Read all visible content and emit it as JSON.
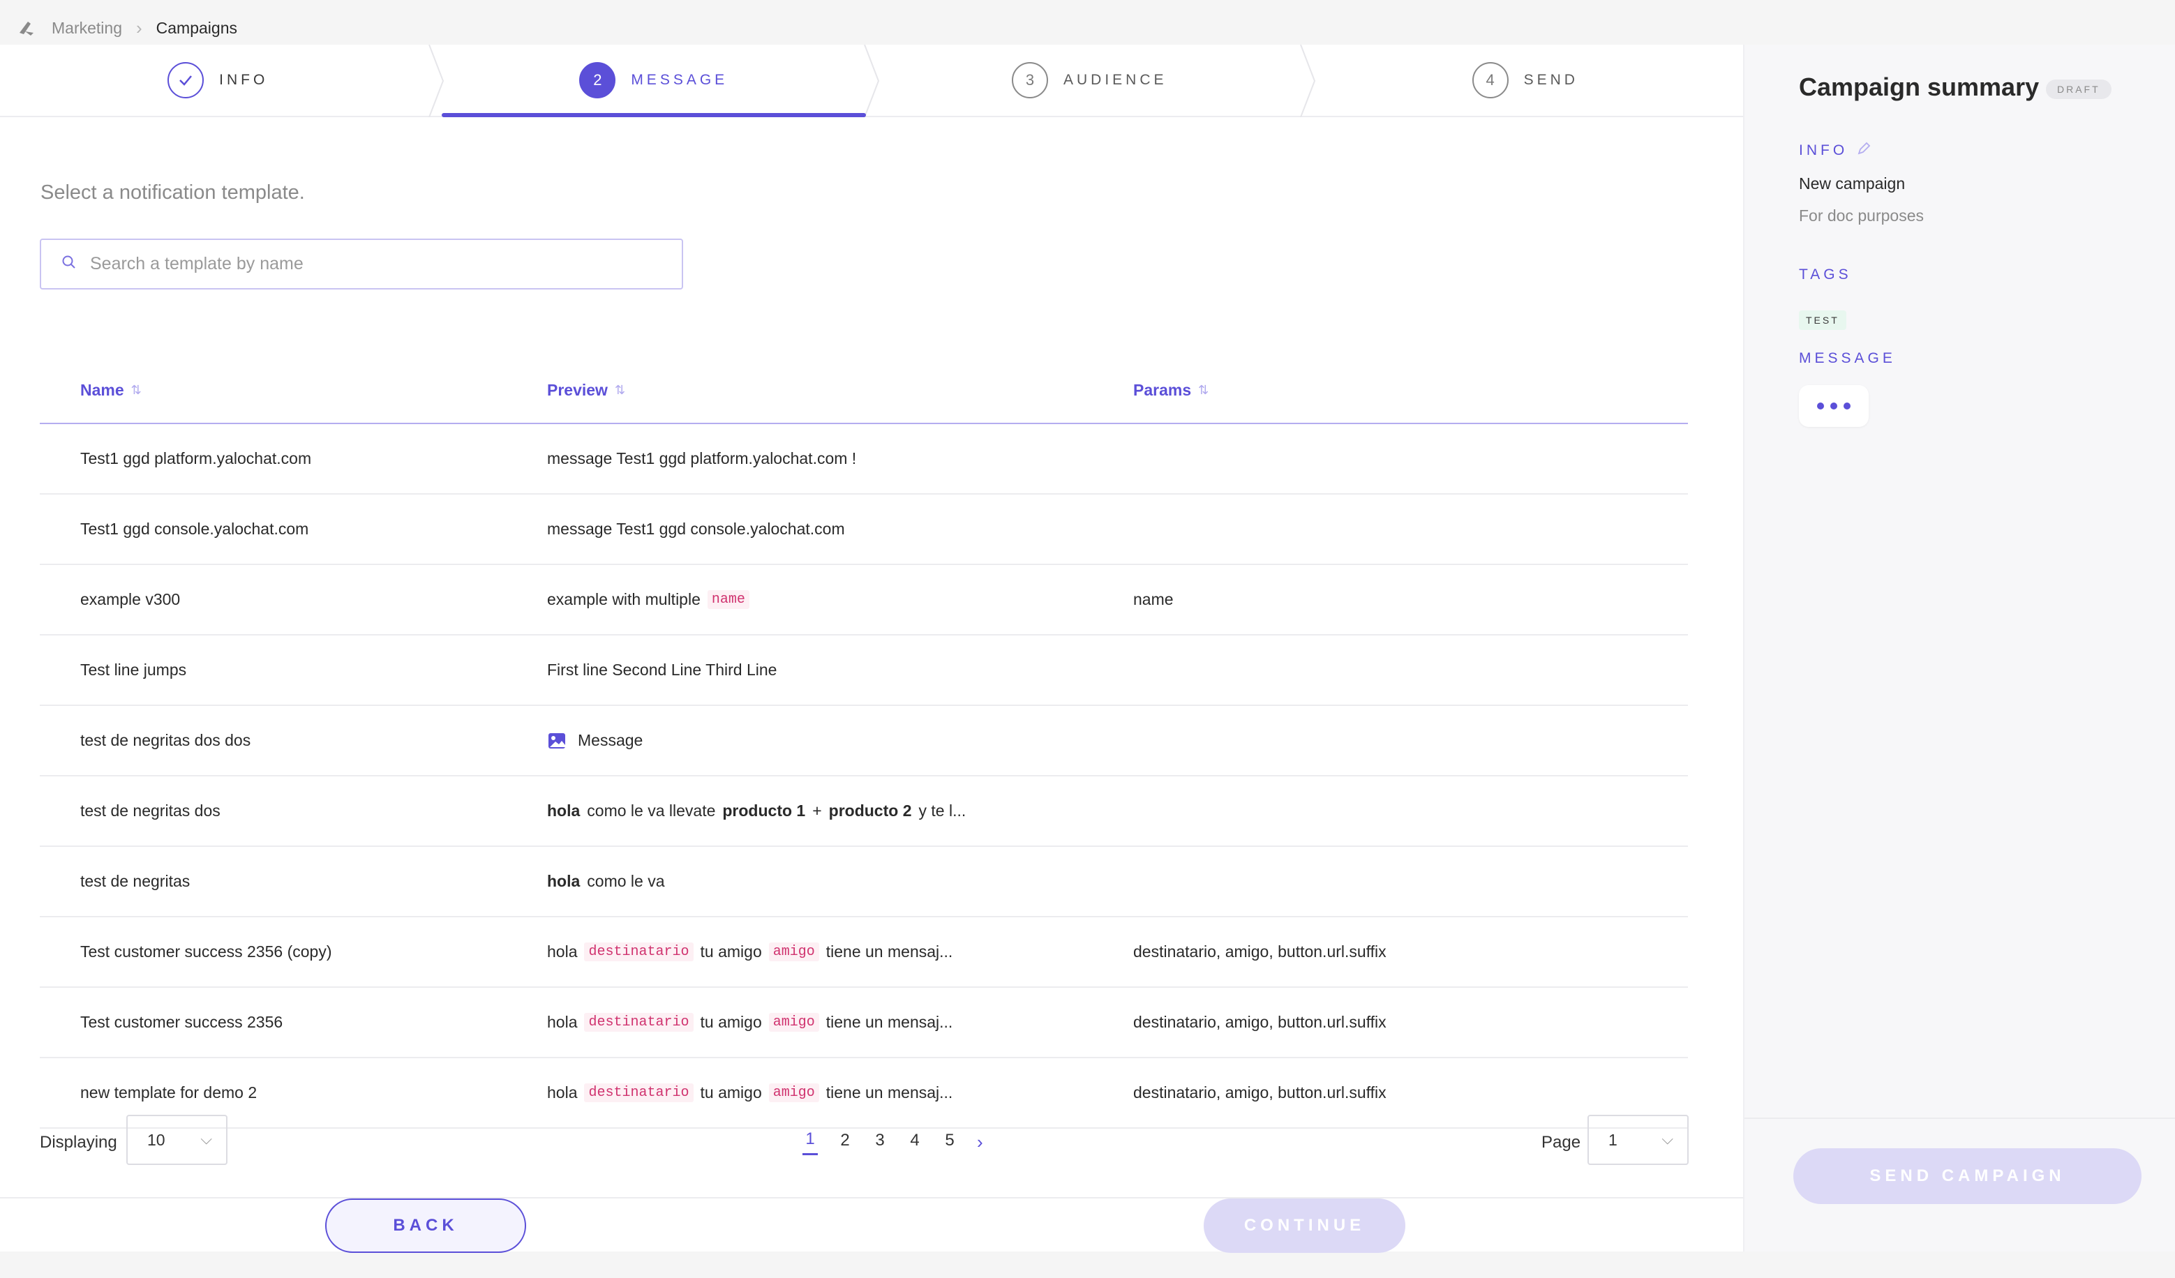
{
  "breadcrumb": {
    "parent": "Marketing",
    "current": "Campaigns"
  },
  "stepper": [
    {
      "number": "",
      "label": "INFO",
      "state": "done"
    },
    {
      "number": "2",
      "label": "MESSAGE",
      "state": "active"
    },
    {
      "number": "3",
      "label": "AUDIENCE",
      "state": "todo"
    },
    {
      "number": "4",
      "label": "SEND",
      "state": "todo"
    }
  ],
  "prompt": "Select a notification template.",
  "search": {
    "placeholder": "Search a template by name",
    "value": ""
  },
  "table": {
    "columns": [
      "Name",
      "Preview",
      "Params"
    ],
    "rows": [
      {
        "name": "Test1 ggd platform.yalochat.com",
        "preview": [
          {
            "t": "text",
            "v": "message Test1 ggd platform.yalochat.com !"
          }
        ],
        "params": ""
      },
      {
        "name": "Test1 ggd console.yalochat.com",
        "preview": [
          {
            "t": "text",
            "v": "message Test1 ggd console.yalochat.com"
          }
        ],
        "params": ""
      },
      {
        "name": "example v300",
        "preview": [
          {
            "t": "text",
            "v": "example with multiple"
          },
          {
            "t": "tag",
            "v": "name"
          }
        ],
        "params": "name"
      },
      {
        "name": "Test line jumps",
        "preview": [
          {
            "t": "text",
            "v": "First line Second Line Third Line"
          }
        ],
        "params": ""
      },
      {
        "name": "test de negritas dos dos",
        "preview": [
          {
            "t": "img",
            "v": ""
          },
          {
            "t": "text",
            "v": "Message"
          }
        ],
        "params": ""
      },
      {
        "name": "test de negritas dos",
        "preview": [
          {
            "t": "bold",
            "v": "hola"
          },
          {
            "t": "text",
            "v": "como le va llevate"
          },
          {
            "t": "bold",
            "v": "producto 1"
          },
          {
            "t": "text",
            "v": "+"
          },
          {
            "t": "bold",
            "v": "producto 2"
          },
          {
            "t": "text",
            "v": "y te l..."
          }
        ],
        "params": ""
      },
      {
        "name": "test de negritas",
        "preview": [
          {
            "t": "bold",
            "v": "hola"
          },
          {
            "t": "text",
            "v": "como le va"
          }
        ],
        "params": ""
      },
      {
        "name": "Test customer success 2356 (copy)",
        "preview": [
          {
            "t": "text",
            "v": "hola"
          },
          {
            "t": "tag",
            "v": "destinatario"
          },
          {
            "t": "text",
            "v": "tu amigo"
          },
          {
            "t": "tag",
            "v": "amigo"
          },
          {
            "t": "text",
            "v": "tiene un mensaj..."
          }
        ],
        "params": "destinatario, amigo, button.url.suffix"
      },
      {
        "name": "Test customer success 2356",
        "preview": [
          {
            "t": "text",
            "v": "hola"
          },
          {
            "t": "tag",
            "v": "destinatario"
          },
          {
            "t": "text",
            "v": "tu amigo"
          },
          {
            "t": "tag",
            "v": "amigo"
          },
          {
            "t": "text",
            "v": "tiene un mensaj..."
          }
        ],
        "params": "destinatario, amigo, button.url.suffix"
      },
      {
        "name": "new template for demo 2",
        "preview": [
          {
            "t": "text",
            "v": "hola"
          },
          {
            "t": "tag",
            "v": "destinatario"
          },
          {
            "t": "text",
            "v": "tu amigo"
          },
          {
            "t": "tag",
            "v": "amigo"
          },
          {
            "t": "text",
            "v": "tiene un mensaj..."
          }
        ],
        "params": "destinatario, amigo, button.url.suffix"
      }
    ]
  },
  "pagination": {
    "displaying_label": "Displaying",
    "displaying_value": "10",
    "pages": [
      "1",
      "2",
      "3",
      "4",
      "5"
    ],
    "current_page": "1",
    "page_label": "Page",
    "page_value": "1"
  },
  "buttons": {
    "back": "BACK",
    "continue": "CONTINUE"
  },
  "summary": {
    "title": "Campaign summary",
    "status": "DRAFT",
    "info_label": "INFO",
    "campaign_name": "New campaign",
    "campaign_description": "For doc purposes",
    "tags_label": "TAGS",
    "tag": "TEST",
    "message_label": "MESSAGE",
    "send_button": "SEND CAMPAIGN"
  },
  "colors": {
    "accent": "#5b4fd8",
    "tag_text": "#d0336f",
    "disabled_button": "#dcd9f6"
  }
}
